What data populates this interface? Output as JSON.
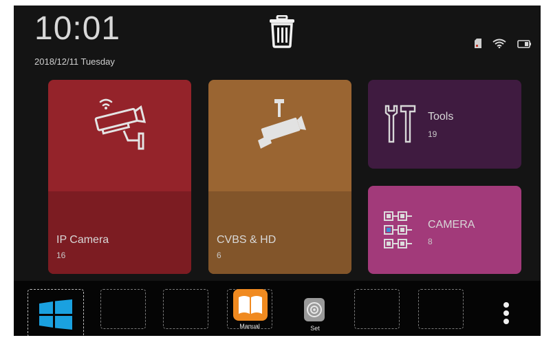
{
  "header": {
    "time": "10:01",
    "date": "2018/12/11 Tuesday",
    "status_icons": [
      "sd-card-icon",
      "wifi-icon",
      "battery-icon"
    ]
  },
  "tiles": {
    "ip_camera": {
      "label": "IP Camera",
      "count": "16",
      "icon": "cctv-camera-wireless-icon",
      "color": "#94232a"
    },
    "cvbs_hd": {
      "label": "CVBS & HD",
      "count": "6",
      "icon": "cctv-camera-icon",
      "color": "#9a6532"
    },
    "tools": {
      "label": "Tools",
      "count": "19",
      "icon": "tools-icon",
      "color": "#3f1b40"
    },
    "camera": {
      "label": "CAMERA",
      "count": "8",
      "icon": "camera-grid-icon",
      "color": "#a23a7a"
    }
  },
  "dock": {
    "apps": [
      {
        "name": "windows",
        "label": "",
        "icon": "windows-icon"
      },
      {
        "name": "empty-1",
        "label": "",
        "icon": ""
      },
      {
        "name": "empty-2",
        "label": "",
        "icon": ""
      },
      {
        "name": "manual",
        "label": "Manual",
        "icon": "book-icon"
      },
      {
        "name": "set",
        "label": "Set",
        "icon": "settings-gear-icon"
      },
      {
        "name": "empty-3",
        "label": "",
        "icon": ""
      },
      {
        "name": "empty-4",
        "label": "",
        "icon": ""
      }
    ],
    "more_icon": "more-vertical-icon"
  },
  "colors": {
    "background": "#141414",
    "dock": "#050505",
    "windows_blue": "#1aa1e0",
    "manual_orange": "#f08a20"
  }
}
